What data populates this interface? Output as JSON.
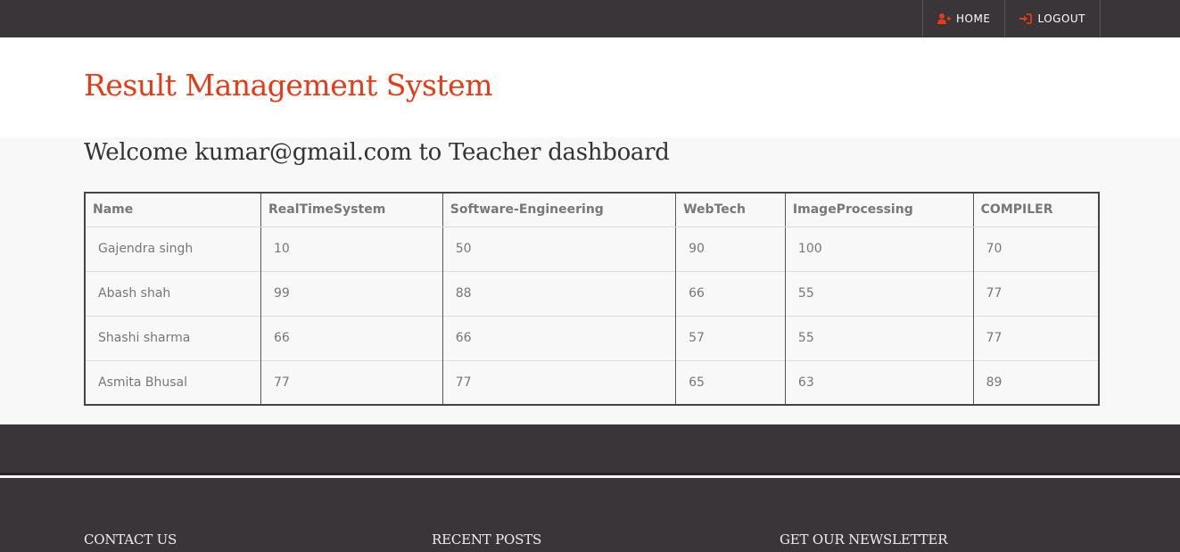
{
  "nav": {
    "home_label": "HOME",
    "logout_label": "LOGOUT",
    "home_icon": "user-plus-icon",
    "logout_icon": "sign-in-icon",
    "icon_color": "#e63b14"
  },
  "header": {
    "brand": "Result Management System"
  },
  "main": {
    "welcome": "Welcome kumar@gmail.com to Teacher dashboard"
  },
  "table": {
    "columns": [
      "Name",
      "RealTimeSystem",
      "Software-Engineering",
      "WebTech",
      "ImageProcessing",
      "COMPILER"
    ],
    "rows": [
      [
        "Gajendra singh",
        "10",
        "50",
        "90",
        "100",
        "70"
      ],
      [
        "Abash shah",
        "99",
        "88",
        "66",
        "55",
        "77"
      ],
      [
        "Shashi sharma",
        "66",
        "66",
        "57",
        "55",
        "77"
      ],
      [
        "Asmita Bhusal",
        "77",
        "77",
        "65",
        "63",
        "89"
      ]
    ]
  },
  "footer": {
    "col1": "CONTACT US",
    "col2": "RECENT POSTS",
    "col3": "GET OUR NEWSLETTER"
  }
}
